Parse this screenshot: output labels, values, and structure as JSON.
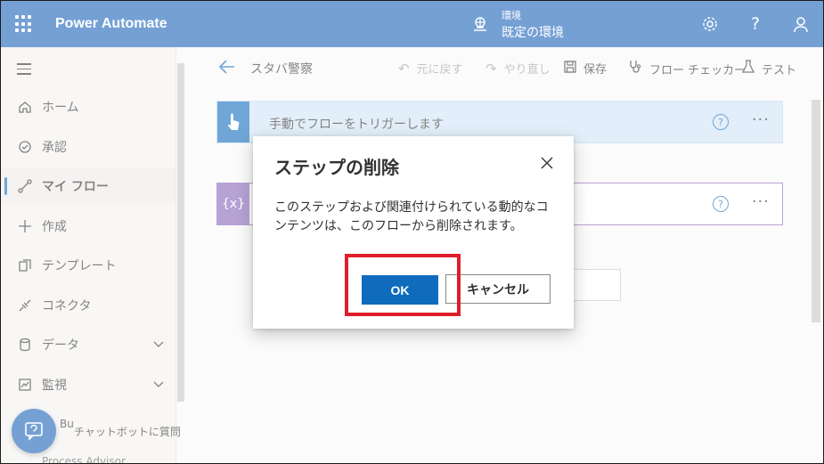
{
  "topbar": {
    "app_title": "Power Automate",
    "env_label": "環境",
    "env_name": "既定の環境",
    "background": "#1a61b8"
  },
  "sidebar": {
    "items": [
      {
        "label": "ホーム",
        "icon": "home-icon"
      },
      {
        "label": "承認",
        "icon": "approvals-icon"
      },
      {
        "label": "マイ フロー",
        "icon": "my-flows-icon",
        "active": true
      },
      {
        "label": "作成",
        "icon": "plus-icon"
      },
      {
        "label": "テンプレート",
        "icon": "templates-icon"
      },
      {
        "label": "コネクタ",
        "icon": "connector-icon"
      },
      {
        "label": "データ",
        "icon": "database-icon",
        "expandable": true
      },
      {
        "label": "監視",
        "icon": "monitor-icon",
        "expandable": true
      }
    ],
    "chatbot_text_prefix": "Bu",
    "chatbot_text": "チャットボットに質問",
    "cutoff_text": "Process Advisor"
  },
  "cmdbar": {
    "flow_name": "スタバ警察",
    "undo": "元に戻す",
    "redo": "やり直し",
    "save": "保存",
    "flow_checker": "フロー チェッカー",
    "test": "テスト"
  },
  "cards": {
    "trigger_title": "手動でフローをトリガーします",
    "help": "?",
    "more": "···"
  },
  "dialog": {
    "title": "ステップの削除",
    "body": "このステップおよび関連付けられている動的なコンテンツは、このフローから削除されます。",
    "ok": "OK",
    "cancel": "キャンセル",
    "highlight_color": "#e01e2a"
  }
}
